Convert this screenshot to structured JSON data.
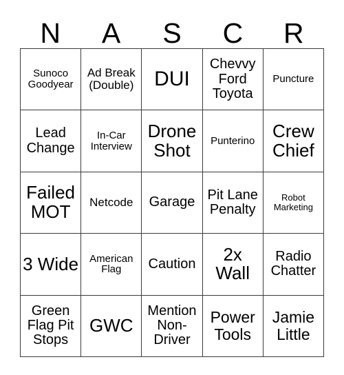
{
  "card": {
    "header_letters": [
      "N",
      "A",
      "S",
      "C",
      "R"
    ],
    "columns": 5,
    "rows": 5,
    "grid_line_color": "#3a3a3a",
    "background_color": "#ffffff",
    "text_color": "#000000",
    "cells": [
      {
        "text": "Sunoco Goodyear",
        "size": "xs"
      },
      {
        "text": "Ad Break (Double)",
        "size": "sm"
      },
      {
        "text": "DUI",
        "size": "xxl"
      },
      {
        "text": "Chevvy Ford Toyota",
        "size": "md"
      },
      {
        "text": "Puncture",
        "size": "xs"
      },
      {
        "text": "Lead Change",
        "size": "md"
      },
      {
        "text": "In-Car Interview",
        "size": "xs"
      },
      {
        "text": "Drone Shot",
        "size": "xl"
      },
      {
        "text": "Punterino",
        "size": "xs"
      },
      {
        "text": "Crew Chief",
        "size": "xl"
      },
      {
        "text": "Failed MOT",
        "size": "xl"
      },
      {
        "text": "Netcode",
        "size": "sm"
      },
      {
        "text": "Garage",
        "size": "md"
      },
      {
        "text": "Pit Lane Penalty",
        "size": "md"
      },
      {
        "text": "Robot Marketing",
        "size": "xxs"
      },
      {
        "text": "3 Wide",
        "size": "xl"
      },
      {
        "text": "American Flag",
        "size": "xs"
      },
      {
        "text": "Caution",
        "size": "md"
      },
      {
        "text": "2x Wall",
        "size": "xl"
      },
      {
        "text": "Radio Chatter",
        "size": "md"
      },
      {
        "text": "Green Flag Pit Stops",
        "size": "md"
      },
      {
        "text": "GWC",
        "size": "xl"
      },
      {
        "text": "Mention Non-Driver",
        "size": "md"
      },
      {
        "text": "Power Tools",
        "size": "lg"
      },
      {
        "text": "Jamie Little",
        "size": "lg"
      }
    ]
  }
}
